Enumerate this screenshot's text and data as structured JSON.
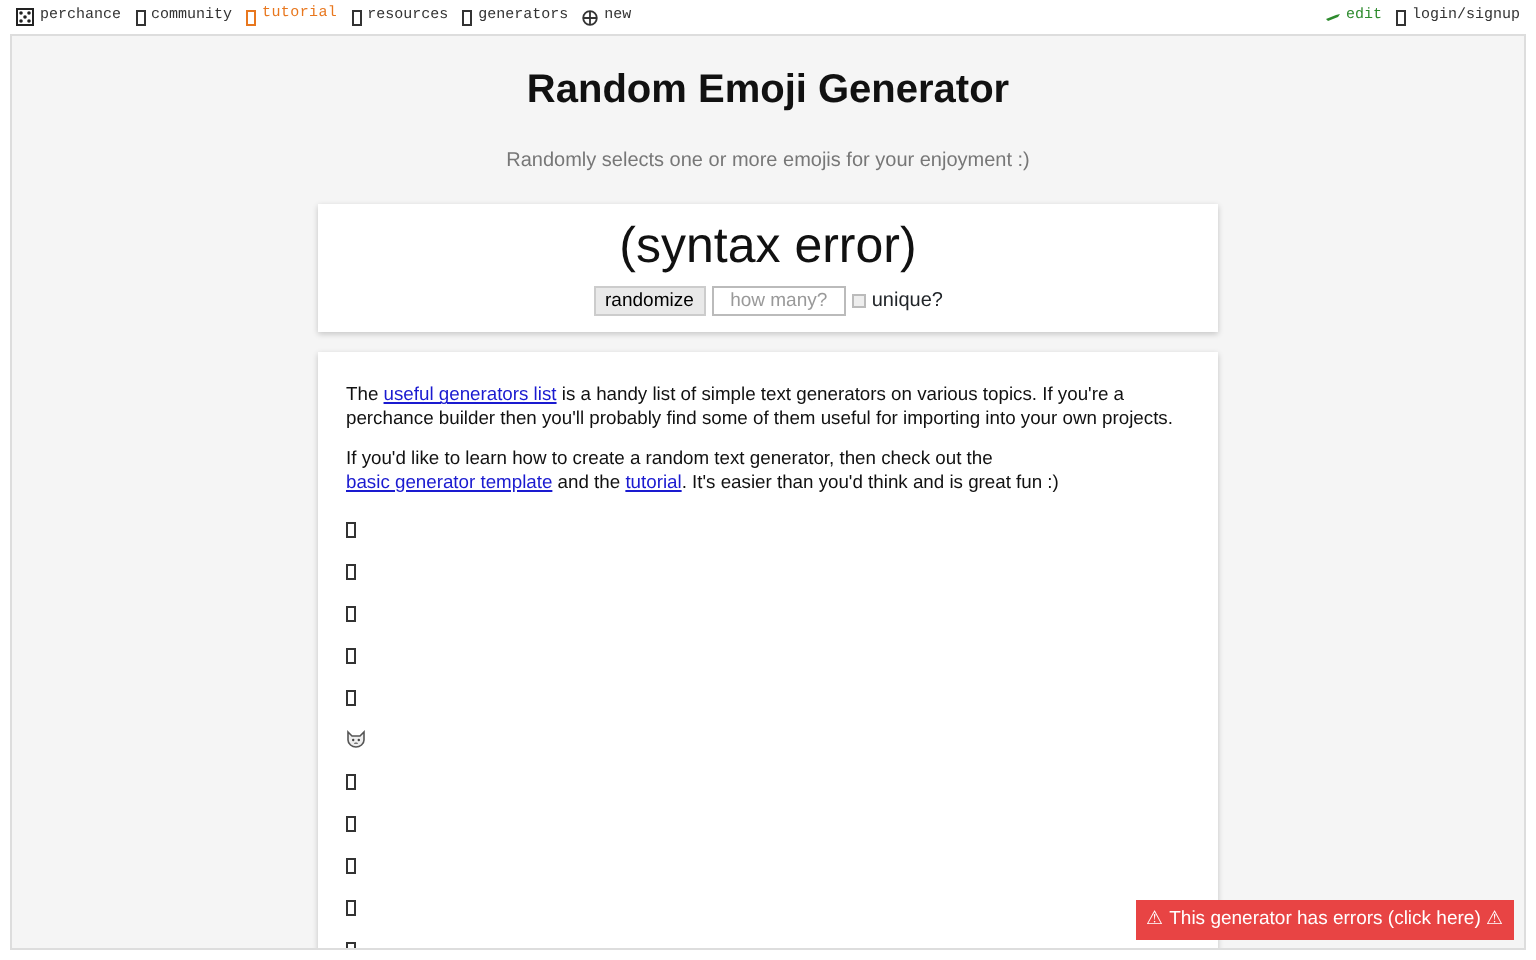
{
  "nav_left": [
    {
      "label": "perchance",
      "kind": "dice",
      "selected": false,
      "color": "#333333"
    },
    {
      "label": "community",
      "kind": "missing",
      "selected": false,
      "color": "#333333"
    },
    {
      "label": "tutorial",
      "kind": "missing",
      "selected": true,
      "color": "#e8771e"
    },
    {
      "label": "resources",
      "kind": "missing",
      "selected": false,
      "color": "#333333"
    },
    {
      "label": "generators",
      "kind": "missing",
      "selected": false,
      "color": "#333333"
    },
    {
      "label": "new",
      "kind": "globe",
      "selected": false,
      "color": "#333333"
    }
  ],
  "nav_right": [
    {
      "label": "edit",
      "kind": "pencil",
      "selected": false,
      "color": "#2e8b2e"
    },
    {
      "label": "login/signup",
      "kind": "missing",
      "selected": false,
      "color": "#333333"
    }
  ],
  "title": "Random Emoji Generator",
  "subtitle": "Randomly selects one or more emojis for your enjoyment :)",
  "output": "(syntax error)",
  "controls": {
    "button": "randomize",
    "count_placeholder": "how many?",
    "unique_label": "unique?",
    "unique_checked": false
  },
  "info_paragraphs": [
    [
      {
        "text": "The ",
        "link": false
      },
      {
        "text": "useful generators list",
        "link": true
      },
      {
        "text": " is a handy list of simple text generators on various topics. If you're a perchance builder then you'll probably find some of them useful for importing into your own projects.",
        "link": false
      }
    ],
    [
      {
        "text": "If you'd like to learn how to create a random text generator, then check out the ",
        "link": false
      },
      {
        "text": "basic generator template",
        "link": true
      },
      {
        "text": " and the ",
        "link": false
      },
      {
        "text": "tutorial",
        "link": true
      },
      {
        "text": ". It's easier than you'd think and is great fun :)",
        "link": false
      }
    ]
  ],
  "emoji_lines": [
    {
      "kind": "missing"
    },
    {
      "kind": "missing"
    },
    {
      "kind": "missing"
    },
    {
      "kind": "missing"
    },
    {
      "kind": "missing"
    },
    {
      "kind": "cat"
    },
    {
      "kind": "missing"
    },
    {
      "kind": "missing"
    },
    {
      "kind": "missing"
    },
    {
      "kind": "missing"
    },
    {
      "kind": "missing"
    }
  ],
  "error_notice": "⚠ This generator has errors (click here) ⚠"
}
